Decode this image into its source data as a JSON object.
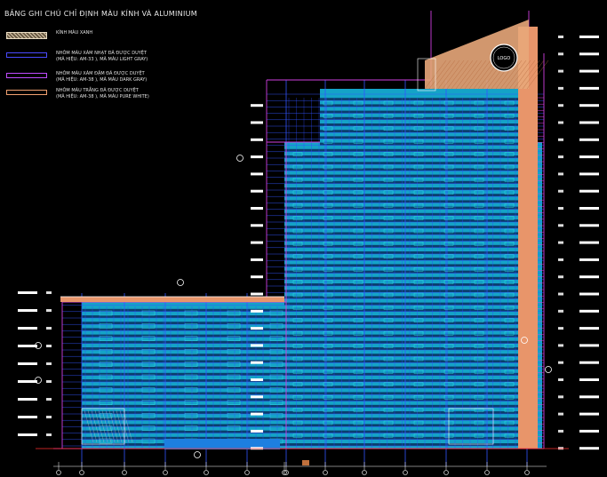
{
  "legend": {
    "title": "BẢNG GHI CHÚ CHỈ ĐỊNH MÀU KÍNH VÀ ALUMINIUM",
    "items": [
      {
        "lines": [
          "KÍNH MÀU XANH"
        ],
        "style": "hatch",
        "color": "#d9c6a8"
      },
      {
        "lines": [
          "NHÔM MÀU XÁM NHẠT ĐÃ ĐƯỢC DUYỆT",
          "(MÃ HIỆU: AM-33 ), MÃ MÀU LIGHT GRAY)"
        ],
        "style": "line",
        "color": "#4a4aff"
      },
      {
        "lines": [
          "NHÔM MÀU XÁM ĐẬM ĐÃ ĐƯỢC DUYỆT",
          "(MÃ HIỆU: AM-38 ), MÃ MÀU DARK GRAY)"
        ],
        "style": "line",
        "color": "#c04cff"
      },
      {
        "lines": [
          "NHÔM MÀU TRẮNG ĐÃ ĐƯỢC DUYỆT",
          "(MÃ HIỆU: AM-38 ), MÃ MÀU PURE WHITE)"
        ],
        "style": "line",
        "color": "#f0a070"
      }
    ]
  },
  "drawing": {
    "logo_text": "LOGO",
    "colors": {
      "glass": "#14a3c7",
      "grid_blue": "#3355ff",
      "magenta": "#d040e0",
      "orange": "#e8956a",
      "cyan_detail": "#38e8e8",
      "white": "#ffffff",
      "ground": "#ff3030"
    }
  }
}
